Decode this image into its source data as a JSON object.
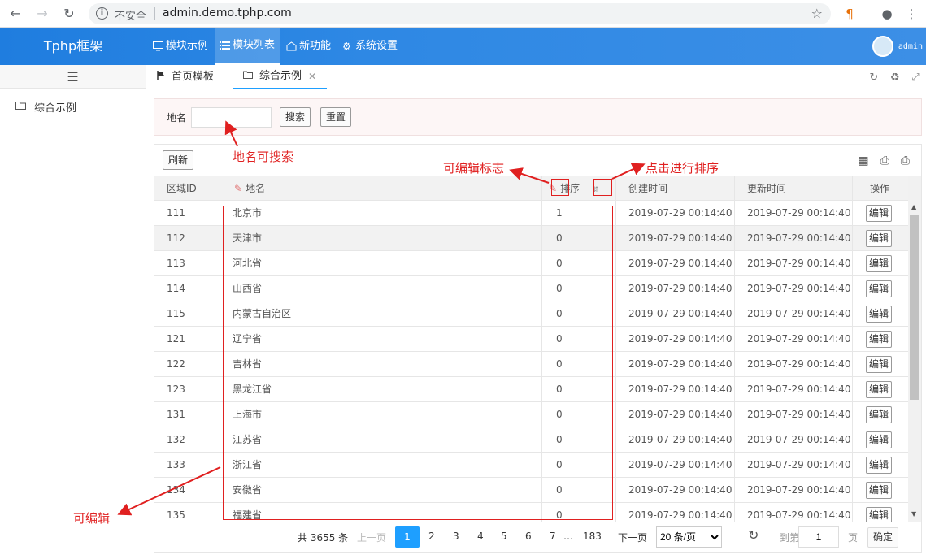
{
  "browser": {
    "security_label": "不安全",
    "url": "admin.demo.tphp.com"
  },
  "header": {
    "brand": "Tphp框架",
    "menu": [
      {
        "label": "模块示例",
        "icon": "monitor-icon"
      },
      {
        "label": "模块列表",
        "icon": "list-icon"
      },
      {
        "label": "新功能",
        "icon": "chat-icon"
      },
      {
        "label": "系统设置",
        "icon": "gear-icon"
      }
    ],
    "username": "admin"
  },
  "sidebar": {
    "items": [
      {
        "label": "综合示例",
        "icon": "folder-icon"
      }
    ]
  },
  "tabs": [
    {
      "label": "首页模板",
      "icon": "flag-icon"
    },
    {
      "label": "综合示例",
      "icon": "folder-icon",
      "active": true
    }
  ],
  "search": {
    "label": "地名",
    "value": "",
    "search_button": "搜索",
    "reset_button": "重置"
  },
  "toolbar": {
    "refresh_button": "刷新"
  },
  "table": {
    "columns": [
      "区域ID",
      "地名",
      "排序",
      "创建时间",
      "更新时间",
      "操作"
    ],
    "edit_label": "编辑",
    "rows": [
      [
        "111",
        "北京市",
        "1",
        "2019-07-29 00:14:40",
        "2019-07-29 00:14:40"
      ],
      [
        "112",
        "天津市",
        "0",
        "2019-07-29 00:14:40",
        "2019-07-29 00:14:40"
      ],
      [
        "113",
        "河北省",
        "0",
        "2019-07-29 00:14:40",
        "2019-07-29 00:14:40"
      ],
      [
        "114",
        "山西省",
        "0",
        "2019-07-29 00:14:40",
        "2019-07-29 00:14:40"
      ],
      [
        "115",
        "内蒙古自治区",
        "0",
        "2019-07-29 00:14:40",
        "2019-07-29 00:14:40"
      ],
      [
        "121",
        "辽宁省",
        "0",
        "2019-07-29 00:14:40",
        "2019-07-29 00:14:40"
      ],
      [
        "122",
        "吉林省",
        "0",
        "2019-07-29 00:14:40",
        "2019-07-29 00:14:40"
      ],
      [
        "123",
        "黑龙江省",
        "0",
        "2019-07-29 00:14:40",
        "2019-07-29 00:14:40"
      ],
      [
        "131",
        "上海市",
        "0",
        "2019-07-29 00:14:40",
        "2019-07-29 00:14:40"
      ],
      [
        "132",
        "江苏省",
        "0",
        "2019-07-29 00:14:40",
        "2019-07-29 00:14:40"
      ],
      [
        "133",
        "浙江省",
        "0",
        "2019-07-29 00:14:40",
        "2019-07-29 00:14:40"
      ],
      [
        "134",
        "安徽省",
        "0",
        "2019-07-29 00:14:40",
        "2019-07-29 00:14:40"
      ],
      [
        "135",
        "福建省",
        "0",
        "2019-07-29 00:14:40",
        "2019-07-29 00:14:40"
      ]
    ]
  },
  "pagination": {
    "total": "共 3655 条",
    "prev": "上一页",
    "pages": [
      "1",
      "2",
      "3",
      "4",
      "5",
      "6",
      "7"
    ],
    "ellipsis": "…",
    "last": "183",
    "next": "下一页",
    "page_size": "20 条/页",
    "goto_label": "到第",
    "goto_value": "1",
    "page_unit": "页",
    "confirm": "确定"
  },
  "annotations": {
    "searchable": "地名可搜索",
    "editable_mark": "可编辑标志",
    "click_sort": "点击进行排序",
    "editable": "可编辑"
  },
  "colors": {
    "header": "#2e88e4",
    "accent": "#1e9fff",
    "annotation": "#e02020"
  }
}
